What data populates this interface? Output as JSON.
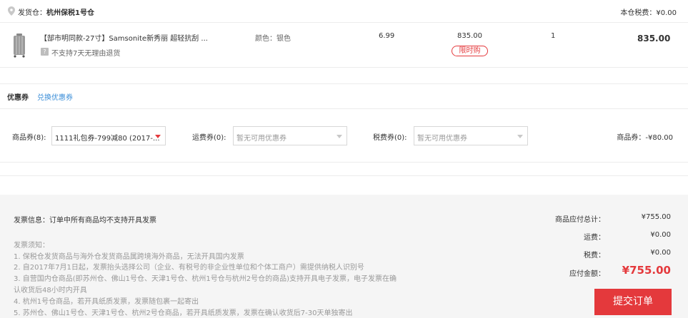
{
  "warehouse": {
    "label": "发货仓：",
    "name": "杭州保税1号仓",
    "tax_label": "本仓税费：¥0.00"
  },
  "product": {
    "title": "【郜市明同款-27寸】Samsonite新秀丽 超轻抗刮 ...",
    "return_policy": "不支持7天无理由退货",
    "color": "颜色：银色",
    "weight": "6.99",
    "price": "835.00",
    "badge": "限时购",
    "quantity": "1",
    "subtotal": "835.00"
  },
  "coupons": {
    "title": "优惠券",
    "exchange_link": "兑换优惠券",
    "product_coupon": {
      "label": "商品券(8):",
      "selected": "1111礼包券-799减80 (2017-..."
    },
    "shipping_coupon": {
      "label": "运费券(0):",
      "placeholder": "暂无可用优惠券"
    },
    "tax_coupon": {
      "label": "税费券(0):",
      "placeholder": "暂无可用优惠券"
    },
    "discount": "商品券：-¥80.00"
  },
  "invoice": {
    "title": "发票信息：订单中所有商品均不支持开具发票",
    "notice_title": "发票须知：",
    "notices": [
      "1. 保税仓发货商品与海外仓发货商品属跨境海外商品，无法开具国内发票",
      "2. 自2017年7月1日起，发票抬头选择公司（企业、有税号的非企业性单位和个体工商户）需提供纳税人识别号",
      "3. 自营国内仓商品(即苏州仓、佛山1号仓、天津1号仓、杭州1号仓与杭州2号仓的商品)支持开具电子发票，电子发票在确",
      "认收货后48小时内开具",
      "4. 杭州1号仓商品，若开具纸质发票，发票随包裹一起寄出",
      "5. 苏州仓、佛山1号仓、天津1号仓、杭州2号仓商品，若开具纸质发票，发票在确认收货后7-30天单独寄出"
    ]
  },
  "summary": {
    "goods_total_label": "商品应付总计：",
    "goods_total": "¥755.00",
    "shipping_label": "运费：",
    "shipping": "¥0.00",
    "tax_label": "税费：",
    "tax": "¥0.00",
    "pay_label": "应付金额：",
    "pay": "¥755.00",
    "submit_label": "提交订单"
  },
  "colors": {
    "accent": "#e4393c",
    "link": "#3b8ed8",
    "panel_bg": "#f5f5f5"
  }
}
